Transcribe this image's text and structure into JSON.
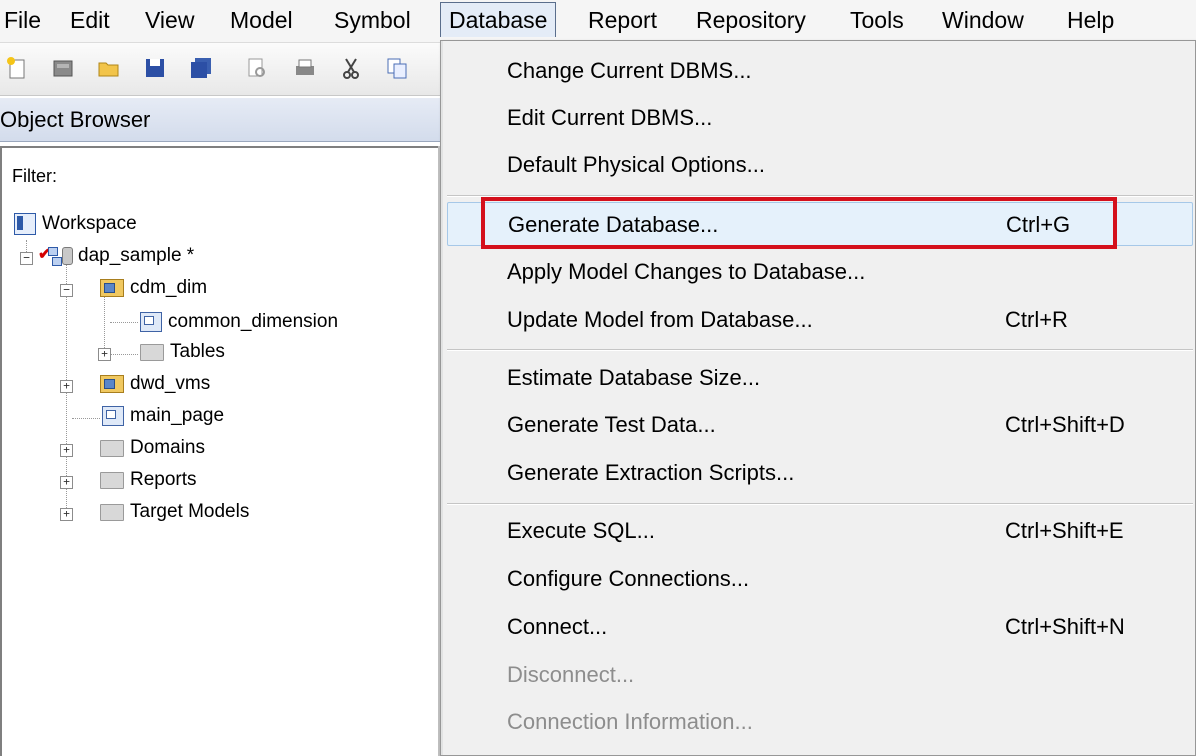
{
  "menubar": {
    "items": [
      {
        "label": "File"
      },
      {
        "label": "Edit"
      },
      {
        "label": "View"
      },
      {
        "label": "Model"
      },
      {
        "label": "Symbol"
      },
      {
        "label": "Database"
      },
      {
        "label": "Report"
      },
      {
        "label": "Repository"
      },
      {
        "label": "Tools"
      },
      {
        "label": "Window"
      },
      {
        "label": "Help"
      }
    ],
    "active": "Database"
  },
  "toolbar": {
    "icons": [
      "new-icon",
      "open-model-icon",
      "open-folder-icon",
      "save-icon",
      "save-all-icon",
      "print-preview-icon",
      "print-icon",
      "cut-icon",
      "copy-icon"
    ]
  },
  "object_browser": {
    "title": "Object Browser",
    "filter_label": "Filter:",
    "filter_value": "",
    "tree": {
      "workspace": "Workspace",
      "model": "dap_sample *",
      "cdm_dim": "cdm_dim",
      "common_dimension": "common_dimension",
      "tables": "Tables",
      "dwd_vms": "dwd_vms",
      "main_page": "main_page",
      "domains": "Domains",
      "reports": "Reports",
      "target_models": "Target Models"
    }
  },
  "database_menu": {
    "items": [
      {
        "label": "Change Current DBMS...",
        "shortcut": "",
        "enabled": true
      },
      {
        "label": "Edit Current DBMS...",
        "shortcut": "",
        "enabled": true
      },
      {
        "label": "Default Physical Options...",
        "shortcut": "",
        "enabled": true
      },
      {
        "label": "Generate Database...",
        "shortcut": "Ctrl+G",
        "enabled": true,
        "highlighted": true
      },
      {
        "label": "Apply Model Changes to Database...",
        "shortcut": "",
        "enabled": true
      },
      {
        "label": "Update Model from Database...",
        "shortcut": "Ctrl+R",
        "enabled": true
      },
      {
        "label": "Estimate Database Size...",
        "shortcut": "",
        "enabled": true
      },
      {
        "label": "Generate Test Data...",
        "shortcut": "Ctrl+Shift+D",
        "enabled": true
      },
      {
        "label": "Generate Extraction Scripts...",
        "shortcut": "",
        "enabled": true
      },
      {
        "label": "Execute SQL...",
        "shortcut": "Ctrl+Shift+E",
        "enabled": true
      },
      {
        "label": "Configure Connections...",
        "shortcut": "",
        "enabled": true
      },
      {
        "label": "Connect...",
        "shortcut": "Ctrl+Shift+N",
        "enabled": true
      },
      {
        "label": "Disconnect...",
        "shortcut": "",
        "enabled": false
      },
      {
        "label": "Connection Information...",
        "shortcut": "",
        "enabled": false
      }
    ]
  },
  "colors": {
    "highlight_box": "#d4101c",
    "hover_bg": "#e5f1fb",
    "disabled_text": "#8d8d8d"
  }
}
